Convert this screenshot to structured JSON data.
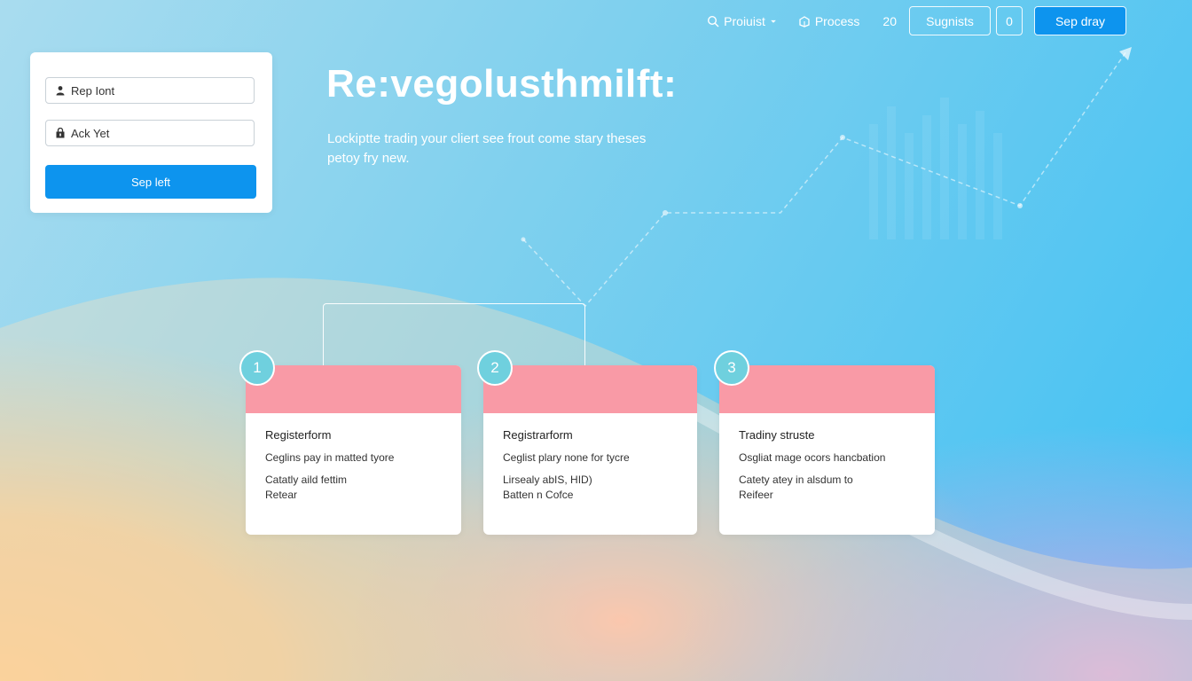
{
  "nav": {
    "products_label": "Proiuist",
    "process_label": "Process",
    "count": "20",
    "signals_label": "Sugnists",
    "zero_label": "0",
    "signup_label": "Sep dray"
  },
  "login": {
    "username_placeholder": "Rep Iont",
    "password_placeholder": "Ack Yet",
    "submit_label": "Sep left"
  },
  "hero": {
    "title": "Re:vegolusthmilft:",
    "subtitle": "Lockiptte tradiŋ your cliert see frout come stary theses petoy fry new."
  },
  "steps": [
    {
      "number": "1",
      "title": "Registerform",
      "line1": "Ceglins pay in matted tyore",
      "line2": "Catatly aild fettim",
      "line3": "Retear"
    },
    {
      "number": "2",
      "title": "Registrarform",
      "line1": "Ceglist plary none for tycre",
      "line2": "Lirsealy abIS, HID)",
      "line3": "Batten n Cofce"
    },
    {
      "number": "3",
      "title": "Tradiny struste",
      "line1": "Osgliat mage ocors hancbation",
      "line2": "Catety atey in alsdum to",
      "line3": "Reifeer"
    }
  ],
  "colors": {
    "primary": "#0d94ee",
    "card_band": "#f99aa6",
    "badge": "#6fd0de"
  }
}
